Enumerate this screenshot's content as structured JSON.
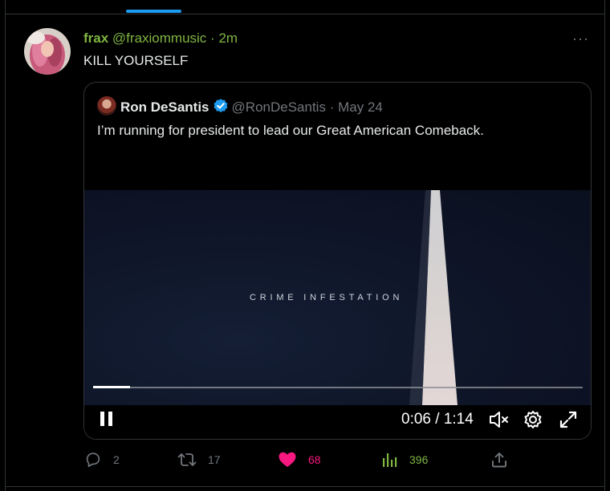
{
  "tweet": {
    "author_name": "frax",
    "author_handle": "@fraxiommusic",
    "separator": "·",
    "time": "2m",
    "text": "KILL YOURSELF",
    "more_label": "···"
  },
  "quoted": {
    "author_name": "Ron DeSantis",
    "author_handle": "@RonDeSantis",
    "separator": "·",
    "date": "May 24",
    "text": "I’m running for president to lead our Great American Comeback.",
    "video": {
      "caption": "CRIME INFESTATION",
      "timecode": "0:06 / 1:14",
      "progress": 0.075
    }
  },
  "actions": {
    "reply_count": "2",
    "retweet_count": "17",
    "like_count": "68",
    "views_count": "396"
  },
  "colors": {
    "accent": "#1d9bf0",
    "name_green": "#7fb542",
    "like_pink": "#f91880",
    "muted": "#71767b"
  }
}
